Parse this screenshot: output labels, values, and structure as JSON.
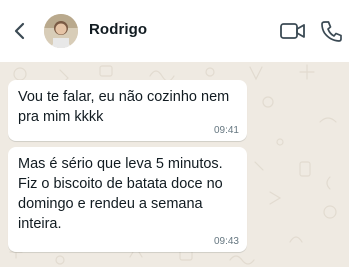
{
  "header": {
    "contact_name": "Rodrigo"
  },
  "messages": [
    {
      "text": "Vou te falar, eu não cozinho nem pra mim kkkk",
      "time": "09:41"
    },
    {
      "text": "Mas é sério que leva 5 minutos. Fiz o biscoito de batata doce no domingo e rendeu a semana inteira.",
      "time": "09:43"
    }
  ],
  "colors": {
    "header_bg": "#ffffff",
    "chat_bg": "#efeae2",
    "bubble_bg": "#ffffff",
    "text": "#111b21",
    "time": "#667781"
  },
  "icons": [
    "back-arrow-icon",
    "video-camera-icon",
    "phone-icon"
  ]
}
